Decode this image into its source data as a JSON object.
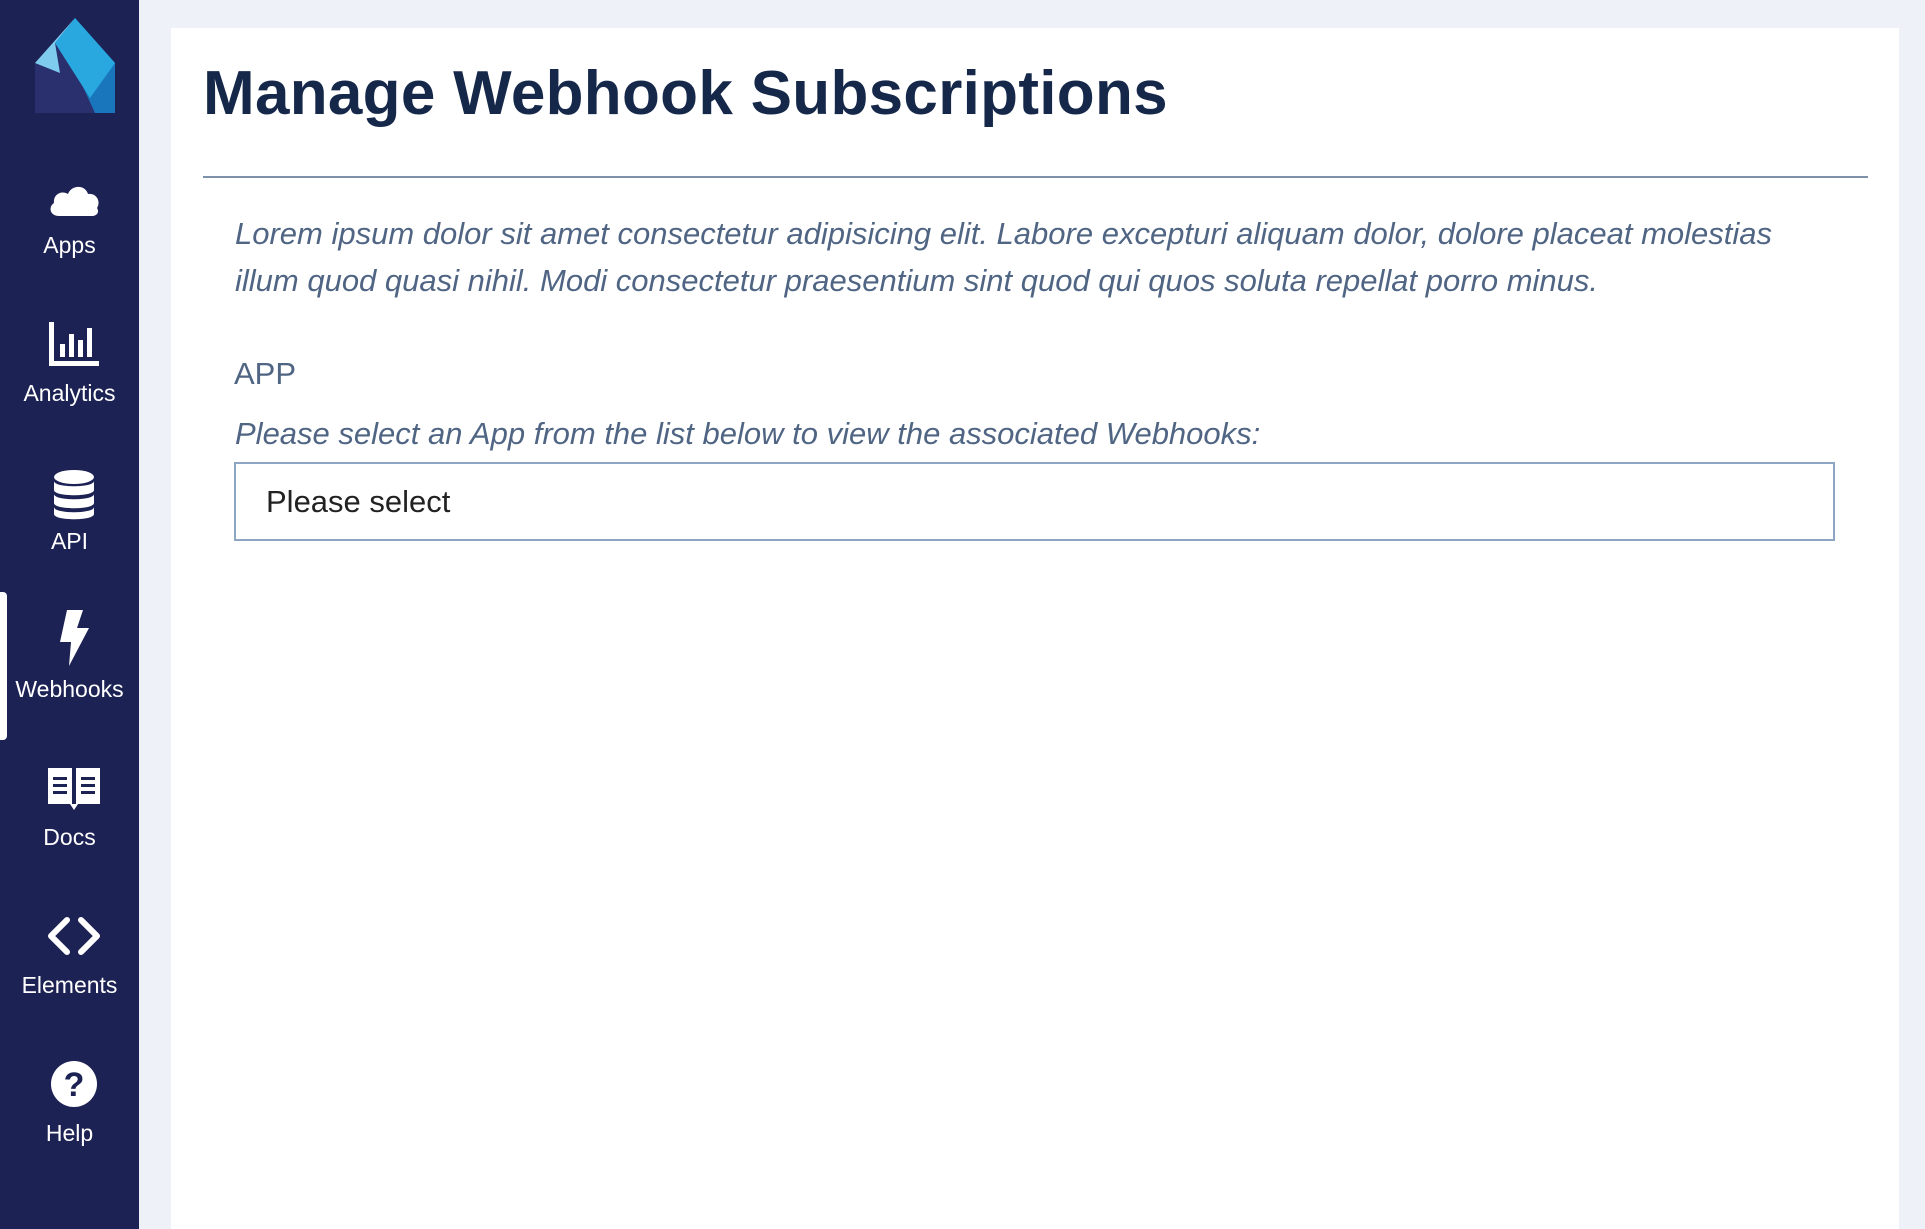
{
  "sidebar": {
    "logo_icon": "app-logo",
    "items": [
      {
        "label": "Apps",
        "icon": "cloud-icon",
        "active": false
      },
      {
        "label": "Analytics",
        "icon": "bar-chart-icon",
        "active": false
      },
      {
        "label": "API",
        "icon": "database-icon",
        "active": false
      },
      {
        "label": "Webhooks",
        "icon": "lightning-icon",
        "active": true
      },
      {
        "label": "Docs",
        "icon": "book-icon",
        "active": false
      },
      {
        "label": "Elements",
        "icon": "code-icon",
        "active": false
      },
      {
        "label": "Help",
        "icon": "question-icon",
        "active": false
      }
    ]
  },
  "main": {
    "title": "Manage Webhook Subscriptions",
    "intro": "Lorem ipsum dolor sit amet consectetur adipisicing elit. Labore excepturi aliquam dolor, dolore placeat molestias illum quod quasi nihil. Modi consectetur praesentium sint quod qui quos soluta repellat porro minus.",
    "app_field": {
      "label": "APP",
      "help": "Please select an App from the list below to view the associated Webhooks:",
      "selected": "Please select"
    }
  },
  "colors": {
    "sidebar_bg": "#1d2254",
    "title": "#16284a",
    "muted_text": "#4f6583",
    "logo_light": "#29a8e0",
    "logo_dark": "#2a2f6d"
  }
}
